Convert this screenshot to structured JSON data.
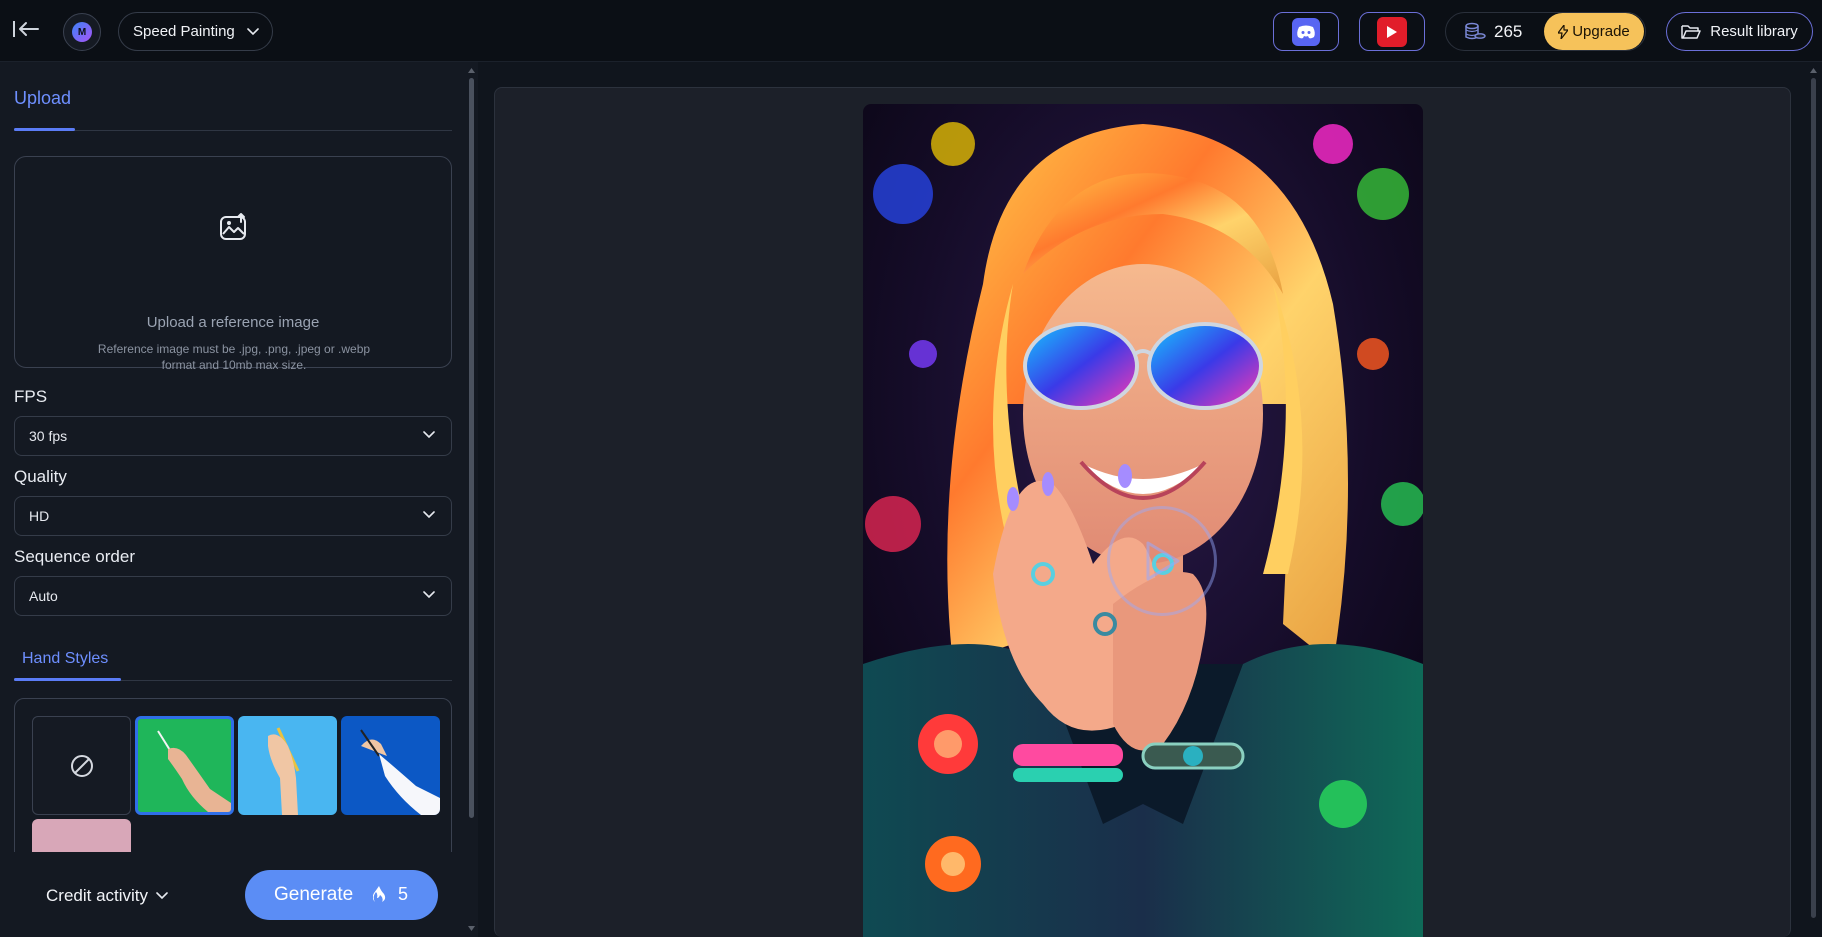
{
  "header": {
    "tool_name": "Speed Painting",
    "credits": "265",
    "upgrade_label": "Upgrade",
    "library_label": "Result library",
    "logo_text": "M"
  },
  "left_panel": {
    "tab_upload": "Upload",
    "upload_title": "Upload a reference image",
    "upload_hint": "Reference image must be .jpg, .png, .jpeg or .webp format and 10mb max size.",
    "fps_label": "FPS",
    "fps_value": "30 fps",
    "quality_label": "Quality",
    "quality_value": "HD",
    "sequence_label": "Sequence order",
    "sequence_value": "Auto",
    "hand_styles_tab": "Hand Styles",
    "hand_styles": [
      "none",
      "green",
      "sky",
      "blue",
      "pink"
    ],
    "selected_hand_style": "green"
  },
  "footer": {
    "credit_activity_label": "Credit activity",
    "generate_label": "Generate",
    "generate_cost": "5"
  },
  "colors": {
    "accent": "#5b8df5",
    "upgrade": "#f6c25a",
    "outline_purple": "#6b6fd8",
    "discord": "#5865f2",
    "youtube": "#e11d2a"
  },
  "icons": [
    "collapse-sidebar-icon",
    "chevron-down-icon",
    "discord-icon",
    "youtube-icon",
    "coins-icon",
    "lightning-icon",
    "folder-icon",
    "image-upload-icon",
    "ban-icon",
    "flame-icon",
    "play-icon"
  ]
}
